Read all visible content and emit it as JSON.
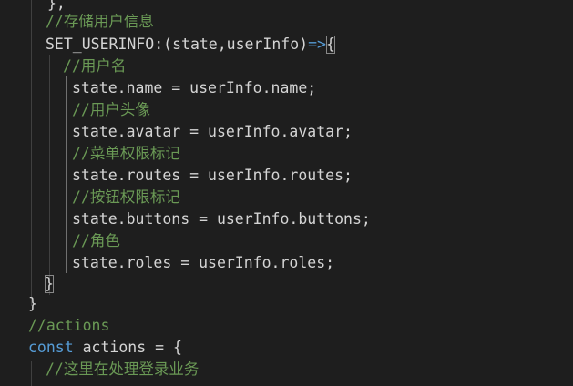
{
  "editor": {
    "lines": [
      {
        "segments": [
          {
            "text": "},",
            "cls": "c-plain"
          }
        ]
      },
      {
        "segments": [
          {
            "text": "//存储用户信息",
            "cls": "c-comment"
          }
        ]
      },
      {
        "segments": [
          {
            "text": "SET_USERINFO:(state,userInfo)",
            "cls": "c-plain"
          },
          {
            "text": "=>",
            "cls": "c-arrow"
          },
          {
            "text": "{",
            "cls": "c-plain",
            "box": true
          }
        ]
      },
      {
        "segments": [
          {
            "text": "//用户名",
            "cls": "c-comment"
          }
        ]
      },
      {
        "segments": [
          {
            "text": "state.name = userInfo.name;",
            "cls": "c-plain"
          }
        ]
      },
      {
        "segments": [
          {
            "text": "//用户头像",
            "cls": "c-comment"
          }
        ]
      },
      {
        "segments": [
          {
            "text": "state.avatar = userInfo.avatar;",
            "cls": "c-plain"
          }
        ]
      },
      {
        "segments": [
          {
            "text": "//菜单权限标记",
            "cls": "c-comment"
          }
        ]
      },
      {
        "segments": [
          {
            "text": "state.routes = userInfo.routes;",
            "cls": "c-plain"
          }
        ]
      },
      {
        "segments": [
          {
            "text": "//按钮权限标记",
            "cls": "c-comment"
          }
        ]
      },
      {
        "segments": [
          {
            "text": "state.buttons = userInfo.buttons;",
            "cls": "c-plain"
          }
        ]
      },
      {
        "segments": [
          {
            "text": "//角色",
            "cls": "c-comment"
          }
        ]
      },
      {
        "segments": [
          {
            "text": "state.roles = userInfo.roles;",
            "cls": "c-plain"
          }
        ]
      },
      {
        "segments": [
          {
            "text": "}",
            "cls": "c-plain",
            "box": true
          }
        ]
      },
      {
        "segments": [
          {
            "text": "}",
            "cls": "c-plain"
          }
        ]
      },
      {
        "segments": [
          {
            "text": "//actions",
            "cls": "c-comment"
          }
        ]
      },
      {
        "segments": [
          {
            "text": "const",
            "cls": "c-keyword"
          },
          {
            "text": " actions = {",
            "cls": "c-plain"
          }
        ]
      },
      {
        "segments": [
          {
            "text": "//这里在处理登录业务",
            "cls": "c-comment"
          }
        ]
      }
    ]
  }
}
